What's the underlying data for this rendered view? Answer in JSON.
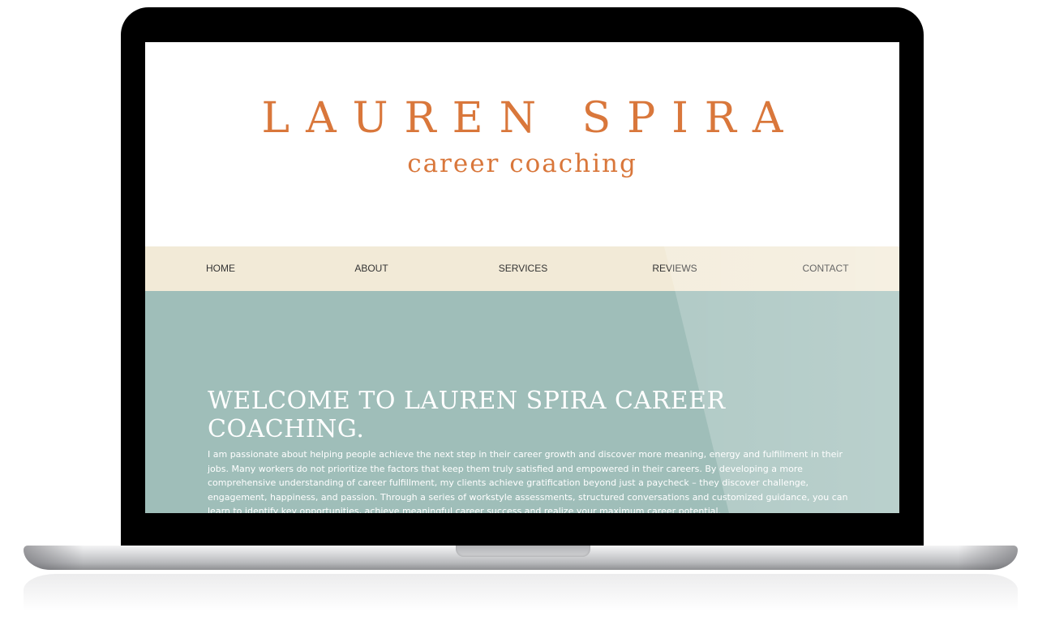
{
  "site": {
    "logo_title": "LAUREN SPIRA",
    "logo_subtitle": "career coaching",
    "brand_color": "#d9773b"
  },
  "nav": {
    "background": "#f2ead7",
    "items": [
      {
        "label": "HOME"
      },
      {
        "label": "ABOUT"
      },
      {
        "label": "SERVICES"
      },
      {
        "label": "REVIEWS"
      },
      {
        "label": "CONTACT"
      }
    ]
  },
  "hero": {
    "background": "#9fbeb9",
    "title": "WELCOME TO LAUREN SPIRA CAREER COACHING.",
    "body": "I am passionate about helping people achieve the next step in their career growth and discover more meaning, energy and fulfillment in their jobs. Many workers do not prioritize the factors that keep them truly satisfied and empowered in their careers. By developing a more comprehensive understanding of career fulfillment, my clients achieve gratification beyond just a paycheck – they discover challenge, engagement, happiness, and passion. Through a series of workstyle assessments, structured conversations and customized guidance, you can learn to identify key opportunities, achieve meaningful career success and realize your maximum career potential."
  },
  "device": {
    "type": "laptop",
    "bezel_color": "#000000",
    "body_color": "#c9cacc"
  }
}
